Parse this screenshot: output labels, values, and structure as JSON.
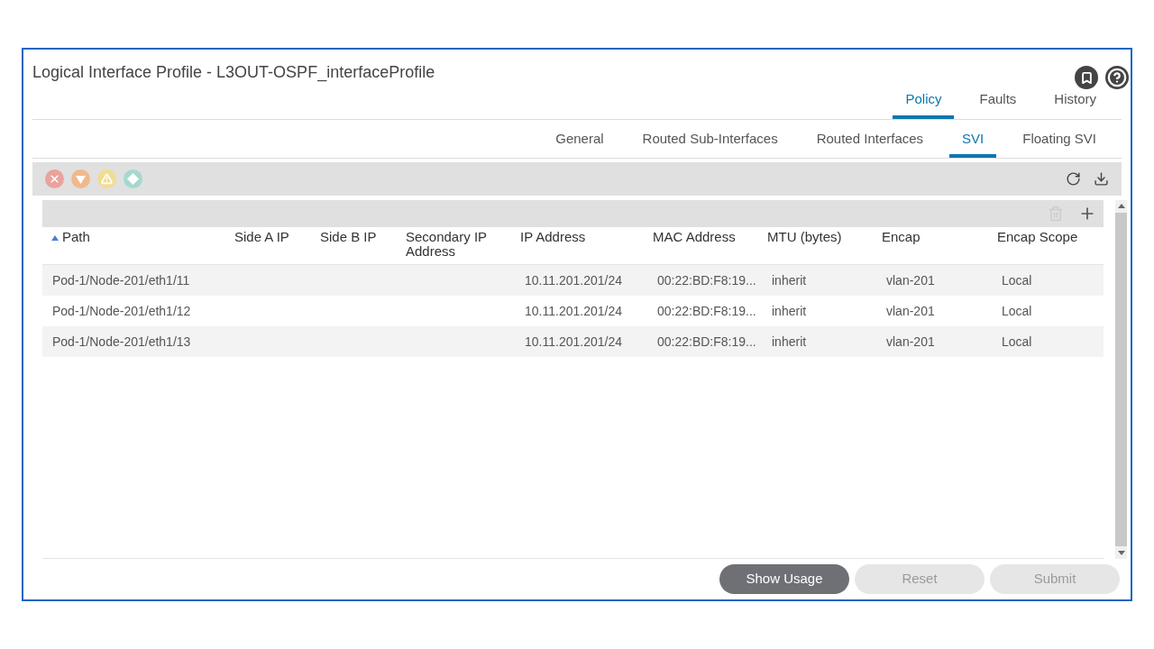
{
  "window": {
    "title": "Logical Interface Profile - L3OUT-OSPF_interfaceProfile"
  },
  "top_tabs": [
    {
      "label": "Policy",
      "selected": true
    },
    {
      "label": "Faults",
      "selected": false
    },
    {
      "label": "History",
      "selected": false
    }
  ],
  "sub_tabs": [
    {
      "label": "General",
      "selected": false
    },
    {
      "label": "Routed Sub-Interfaces",
      "selected": false
    },
    {
      "label": "Routed Interfaces",
      "selected": false
    },
    {
      "label": "SVI",
      "selected": true
    },
    {
      "label": "Floating SVI",
      "selected": false
    }
  ],
  "table": {
    "columns": [
      {
        "label": "Path",
        "sorted": true
      },
      {
        "label": "Side A IP",
        "sorted": false
      },
      {
        "label": "Side B IP",
        "sorted": false
      },
      {
        "label": "Secondary IP Address",
        "sorted": false
      },
      {
        "label": "IP Address",
        "sorted": false
      },
      {
        "label": "MAC Address",
        "sorted": false
      },
      {
        "label": "MTU (bytes)",
        "sorted": false
      },
      {
        "label": "Encap",
        "sorted": false
      },
      {
        "label": "Encap Scope",
        "sorted": false
      }
    ],
    "rows": [
      [
        "Pod-1/Node-201/eth1/11",
        "",
        "",
        "",
        "10.11.201.201/24",
        "00:22:BD:F8:19...",
        "inherit",
        "vlan-201",
        "Local"
      ],
      [
        "Pod-1/Node-201/eth1/12",
        "",
        "",
        "",
        "10.11.201.201/24",
        "00:22:BD:F8:19...",
        "inherit",
        "vlan-201",
        "Local"
      ],
      [
        "Pod-1/Node-201/eth1/13",
        "",
        "",
        "",
        "10.11.201.201/24",
        "00:22:BD:F8:19...",
        "inherit",
        "vlan-201",
        "Local"
      ]
    ]
  },
  "buttons": [
    {
      "label": "Show Usage",
      "disabled": false
    },
    {
      "label": "Reset",
      "disabled": true
    },
    {
      "label": "Submit",
      "disabled": true
    }
  ]
}
